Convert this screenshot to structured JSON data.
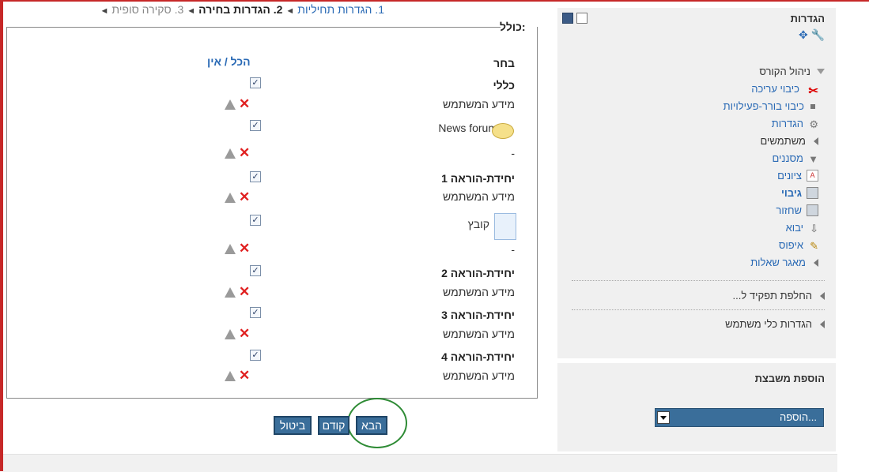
{
  "breadcrumb": {
    "step1": "1. הגדרות תחיליות",
    "step2": "2. הגדרות בחירה",
    "step3": "3. סקירה סופית"
  },
  "backup_form": {
    "legend": "כולל:",
    "select_header": "בחר",
    "all_label": "הכל",
    "divider": "/",
    "none_label": "אין",
    "rows": [
      {
        "label": "כללי"
      },
      {
        "label": "מידע המשתמש"
      },
      {
        "label": "News forum"
      },
      {
        "label": "-"
      },
      {
        "label": "יחידת-הוראה 1"
      },
      {
        "label": "מידע המשתמש"
      },
      {
        "label": "קובץ"
      },
      {
        "label": "-"
      },
      {
        "label": "יחידת-הוראה 2"
      },
      {
        "label": "מידע המשתמש"
      },
      {
        "label": "יחידת-הוראה 3"
      },
      {
        "label": "מידע המשתמש"
      },
      {
        "label": "יחידת-הוראה 4"
      },
      {
        "label": "מידע המשתמש"
      }
    ]
  },
  "buttons": {
    "next": "הבא",
    "prev": "קודם",
    "cancel": "ביטול"
  },
  "settings_block": {
    "title": "הגדרות",
    "course_admin": "ניהול הקורס",
    "items": [
      "כיבוי עריכה",
      "כיבוי בורר-פעילויות",
      "הגדרות",
      "משתמשים",
      "מסננים",
      "ציונים",
      "גיבוי",
      "שחזור",
      "יבוא",
      "איפוס",
      "מאגר שאלות"
    ],
    "switch_role": "החלפת תפקיד ל...",
    "user_settings": "הגדרות כלי משתמש"
  },
  "add_block": {
    "title": "הוספת משבצת",
    "select_value": "הוספה..."
  },
  "colors": {
    "accent": "#3a6e9a",
    "link": "#2a6ab5",
    "highlight_circle": "#2e8b35"
  }
}
